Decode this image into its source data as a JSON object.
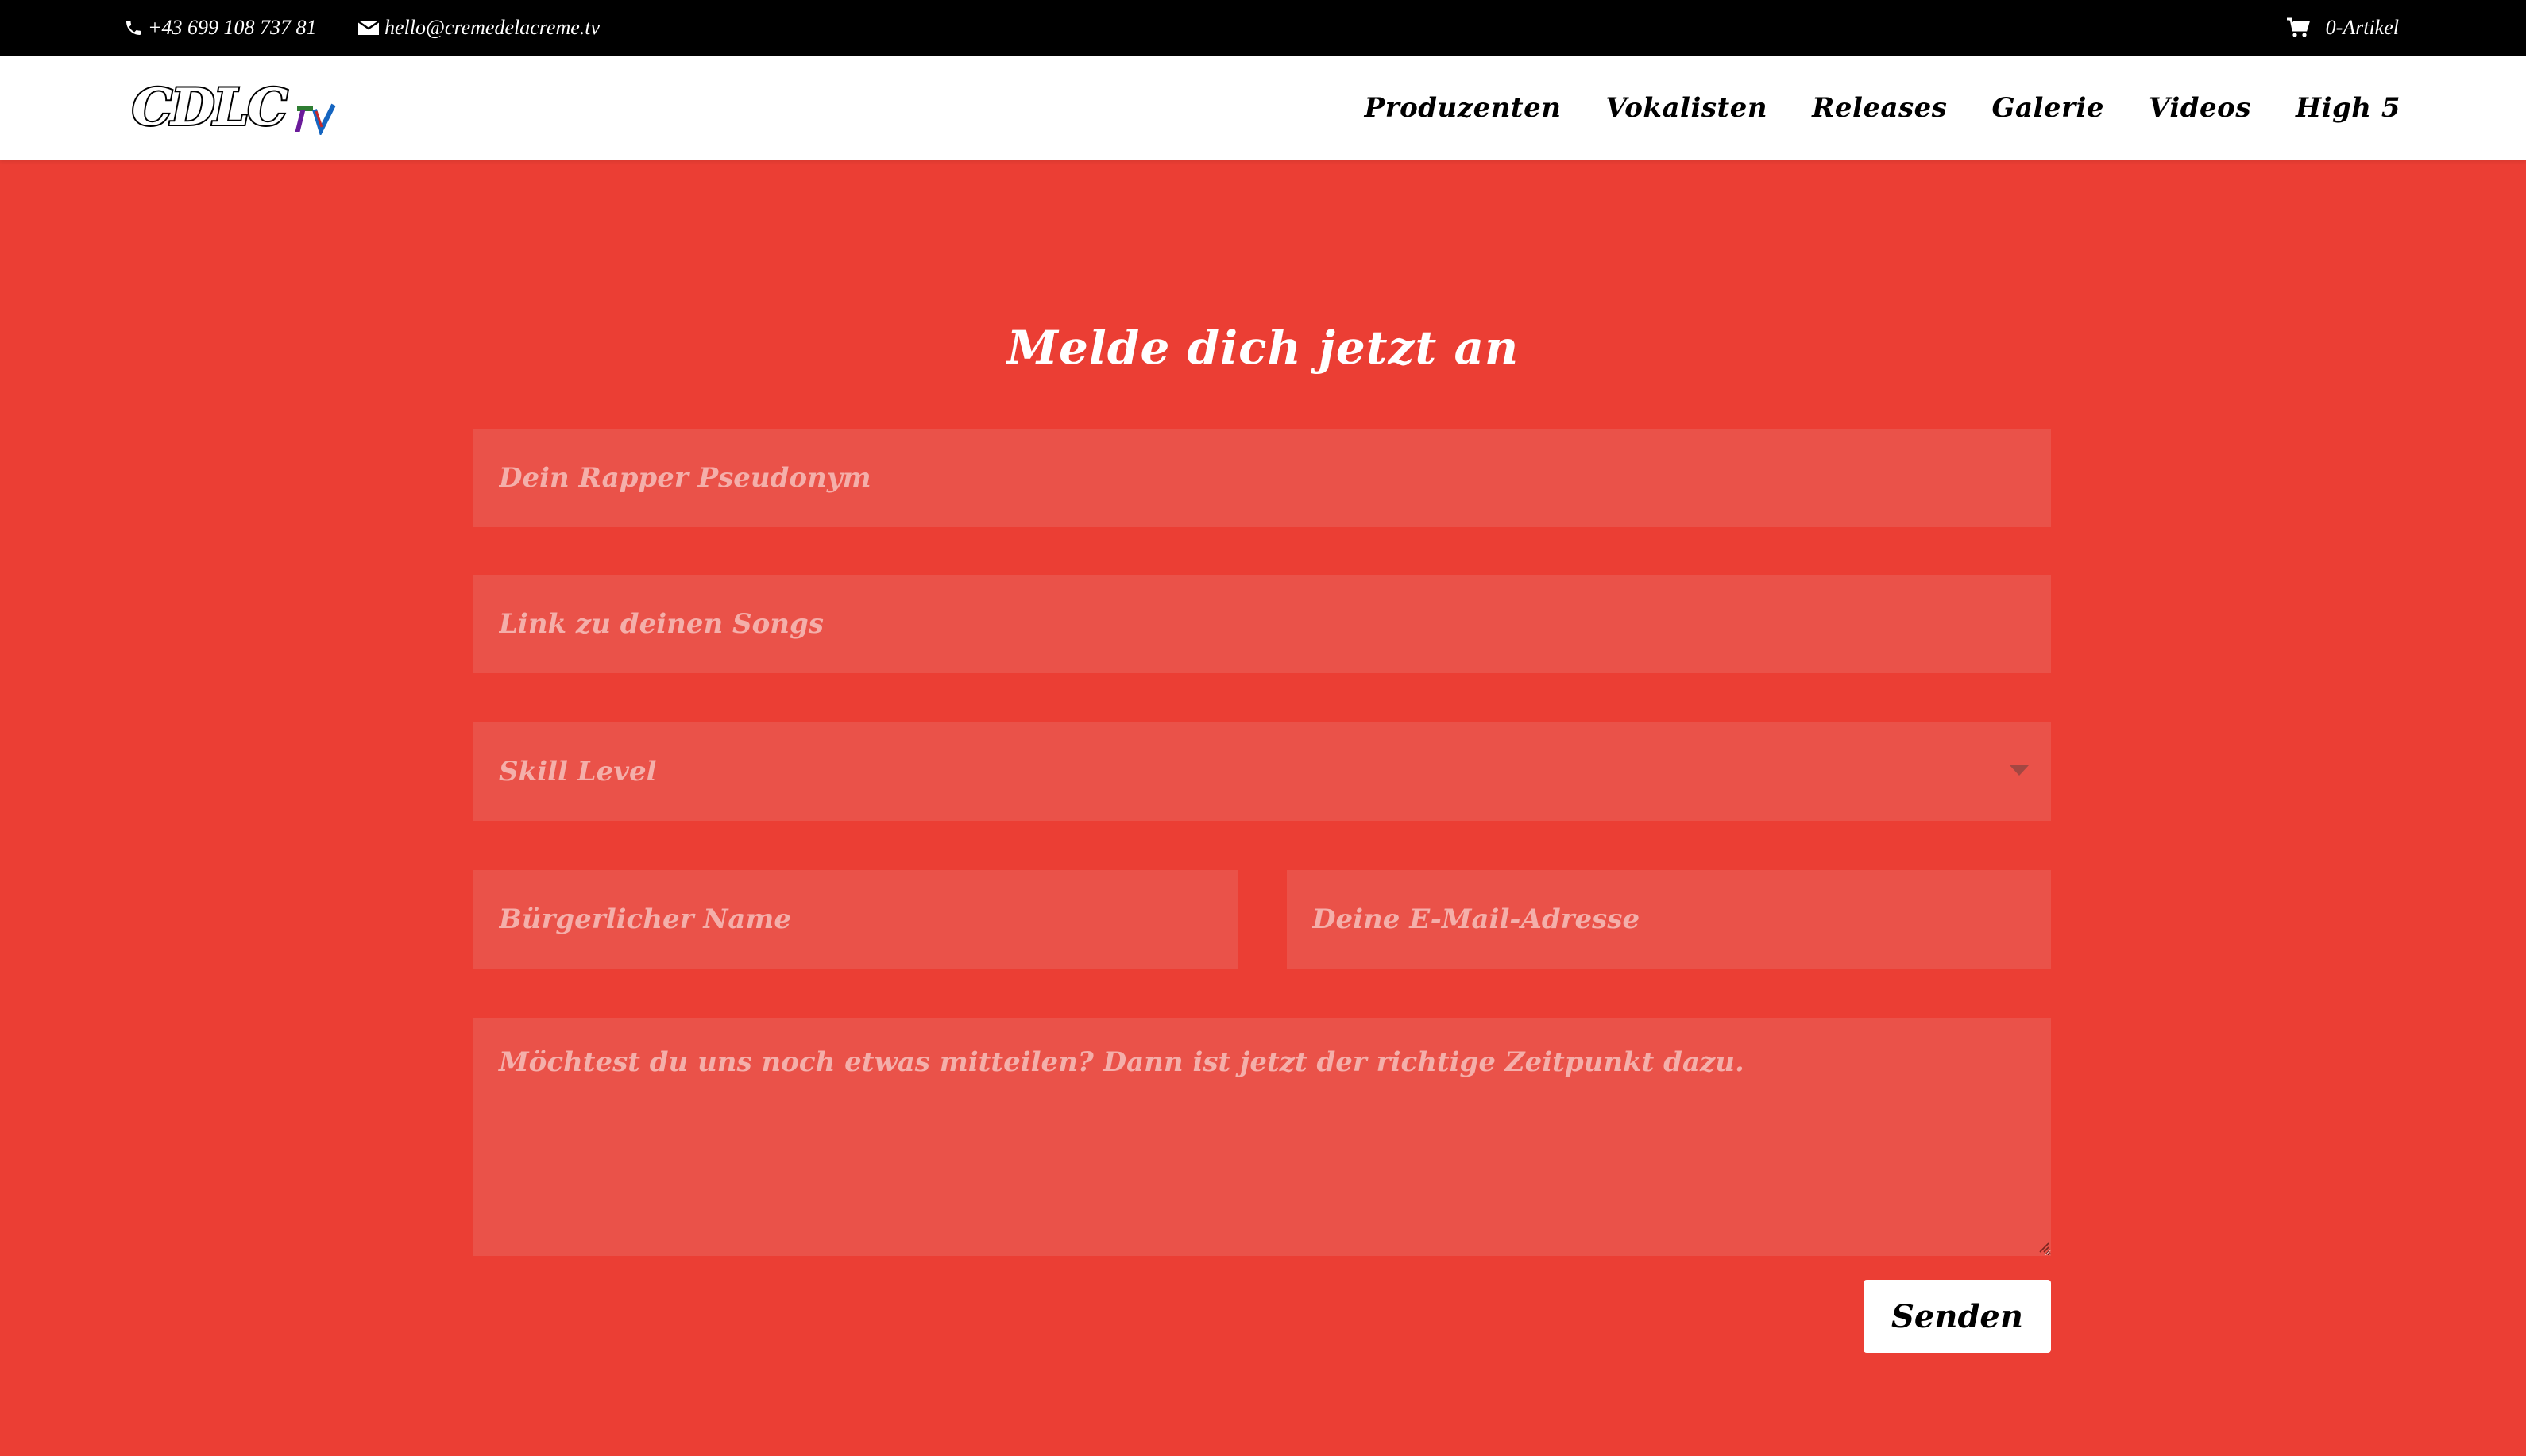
{
  "topbar": {
    "phone": "+43 699 108 737 81",
    "email": "hello@cremedelacreme.tv",
    "cart": "0-Artikel"
  },
  "header": {
    "logo_text": "CDLC",
    "logo_suffix": "tv",
    "nav": [
      "Produzenten",
      "Vokalisten",
      "Releases",
      "Galerie",
      "Videos",
      "High 5"
    ]
  },
  "form": {
    "title": "Melde dich jetzt an",
    "pseudonym_placeholder": "Dein Rapper Pseudonym",
    "songs_placeholder": "Link zu deinen Songs",
    "skill_selected": "Skill Level",
    "name_placeholder": "Bürgerlicher Name",
    "email_placeholder": "Deine E-Mail-Adresse",
    "message_placeholder": "Möchtest du uns noch etwas mitteilen? Dann ist jetzt der richtige Zeitpunkt dazu.",
    "submit_label": "Senden"
  },
  "colors": {
    "background": "#EB3E34",
    "field": "#EA5249",
    "placeholder": "#F4AFAA",
    "topbar": "#000000",
    "header": "#FFFFFF"
  },
  "icons": {
    "phone": "phone-icon",
    "email": "envelope-icon",
    "cart": "cart-icon",
    "select": "caret-down-icon"
  }
}
